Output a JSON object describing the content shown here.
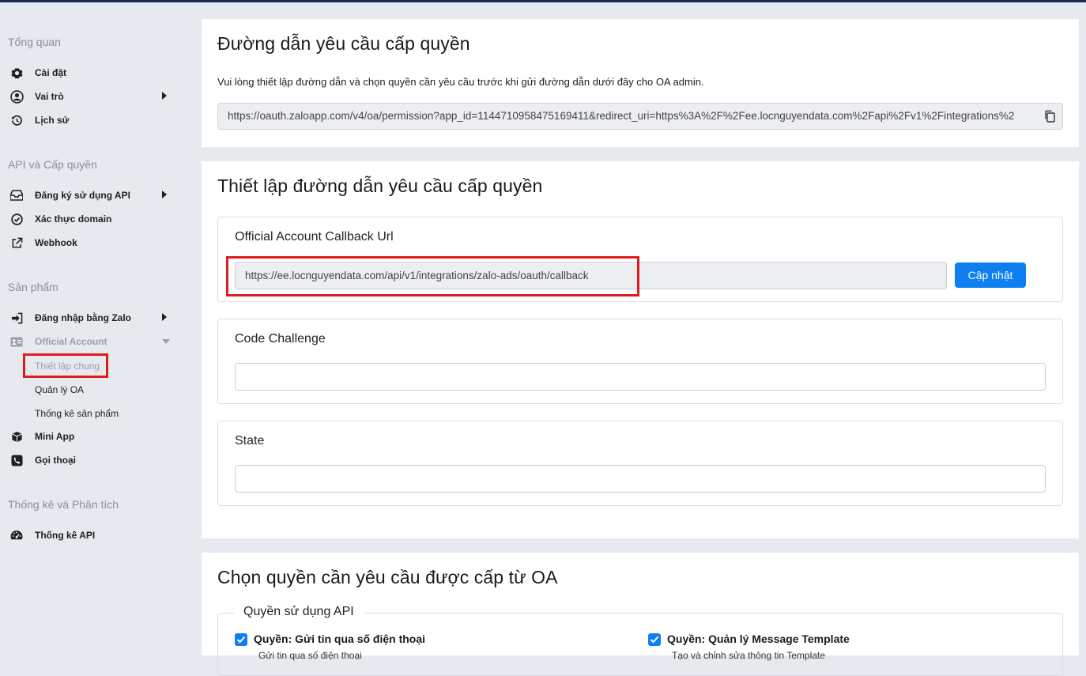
{
  "sidebar": {
    "sections": [
      {
        "title": "Tổng quan"
      },
      {
        "title": "API và Cấp quyền"
      },
      {
        "title": "Sản phẩm"
      },
      {
        "title": "Thống kê và Phân tích"
      }
    ],
    "items": {
      "settings": "Cài đặt",
      "roles": "Vai trò",
      "history": "Lịch sử",
      "api_register": "Đăng ký sử dụng API",
      "domain_verify": "Xác thực domain",
      "webhook": "Webhook",
      "zalo_login": "Đăng nhập bằng Zalo",
      "official_account": "Official Account",
      "general_settings": "Thiết lập chung",
      "oa_manage": "Quản lý OA",
      "product_stats": "Thống kê sản phẩm",
      "mini_app": "Mini App",
      "call": "Gọi thoại",
      "api_stats": "Thống kê API"
    },
    "icons": {
      "settings": "gear-icon",
      "roles": "user-circle-icon",
      "history": "history-icon",
      "api_register": "inbox-icon",
      "domain_verify": "check-circle-icon",
      "webhook": "external-link-icon",
      "zalo_login": "sign-in-icon",
      "official_account": "id-card-icon",
      "mini_app": "cube-icon",
      "call": "phone-icon",
      "api_stats": "dashboard-icon"
    }
  },
  "permission_url_panel": {
    "title": "Đường dẫn yêu cầu cấp quyền",
    "description": "Vui lòng thiết lập đường dẫn và chọn quyền cần yêu cầu trước khi gửi đường dẫn dưới đây cho OA admin.",
    "url": "https://oauth.zaloapp.com/v4/oa/permission?app_id=1144710958475169411&redirect_uri=https%3A%2F%2Fee.locnguyendata.com%2Fapi%2Fv1%2Fintegrations%2"
  },
  "setup_panel": {
    "title": "Thiết lập đường dẫn yêu cầu cấp quyền",
    "callback": {
      "label": "Official Account Callback Url",
      "value": "https://ee.locnguyendata.com/api/v1/integrations/zalo-ads/oauth/callback",
      "button": "Cập nhật"
    },
    "code_challenge": {
      "label": "Code Challenge",
      "value": ""
    },
    "state": {
      "label": "State",
      "value": ""
    }
  },
  "permissions_panel": {
    "title": "Chọn quyền cần yêu cầu được cấp từ OA",
    "group_label": "Quyền sử dụng API",
    "permissions": [
      {
        "label": "Quyền: Gửi tin qua số điện thoại",
        "detail": "Gửi tin qua số điện thoại",
        "checked": true
      },
      {
        "label": "Quyền: Quản lý Message Template",
        "detail": "Tạo và chỉnh sửa thông tin Template",
        "checked": true
      }
    ]
  },
  "colors": {
    "primary": "#0d7ff0",
    "highlight": "#e01b1b",
    "sidebar_bg": "#e6e9ee"
  }
}
